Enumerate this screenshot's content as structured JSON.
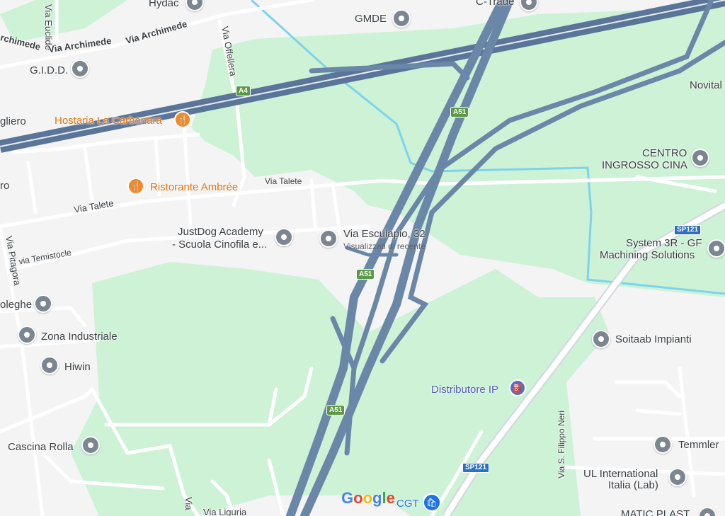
{
  "map": {
    "streets": [
      {
        "id": "via-euclide",
        "text": "Via Euclide"
      },
      {
        "id": "via-archimede-1",
        "text": "rchimede"
      },
      {
        "id": "via-archimede-2",
        "text": "Via Archimede"
      },
      {
        "id": "via-archimede-3",
        "text": "Via Archimede"
      },
      {
        "id": "via-offellera",
        "text": "Via Offellera"
      },
      {
        "id": "via-talete-1",
        "text": "Via Talete"
      },
      {
        "id": "via-talete-2",
        "text": "Via Talete"
      },
      {
        "id": "via-temistocle",
        "text": "via Temistocle"
      },
      {
        "id": "via-pitagora",
        "text": "Via Pitagora"
      },
      {
        "id": "via-s-filippo-neri",
        "text": "Via S. Filippo Neri"
      },
      {
        "id": "via-liguria",
        "text": "Via Liguria"
      },
      {
        "id": "via-partial-left",
        "text": "Via"
      }
    ],
    "shields": [
      {
        "id": "a4",
        "text": "A4"
      },
      {
        "id": "a51-top",
        "text": "A51"
      },
      {
        "id": "a51-mid",
        "text": "A51"
      },
      {
        "id": "a51-bottom",
        "text": "A51"
      },
      {
        "id": "sp121-top",
        "text": "SP121"
      },
      {
        "id": "sp121-bottom",
        "text": "SP121"
      }
    ],
    "places": {
      "hydac": "Hydac",
      "c_trade": "C-Trade",
      "gmde": "GMDE",
      "gidd": "G.I.D.D.",
      "novital": "Novital",
      "gliero": "gliero",
      "hostaria": "Hostaria La Carbonara",
      "ristorante": "Ristorante Ambrée",
      "ro": "ro",
      "centro_ingrosso_1": "CENTRO",
      "centro_ingrosso_2": "INGROSSO CINA",
      "justdog_1": "JustDog Academy",
      "justdog_2": "- Scuola Cinofila e...",
      "via_esculapio": "Via Esculapio, 32",
      "visualizzati": "Visualizzati di recente",
      "system3r_1": "System 3R - GF",
      "system3r_2": "Machining Solutions",
      "oleghe": "oleghe",
      "zona_industriale": "Zona Industriale",
      "soitaab": "Soitaab Impianti",
      "hiwin": "Hiwin",
      "distributore": "Distributore IP",
      "cascina_rolla": "Cascina Rolla",
      "temmler": "Temmler",
      "ul_international_1": "UL International",
      "ul_international_2": "Italia (Lab)",
      "cgt": "CGT",
      "matic_plast": "MATIC PLAST"
    },
    "google_logo": [
      "G",
      "o",
      "o",
      "g",
      "l",
      "e"
    ],
    "colors": {
      "land": "#f4f4f5",
      "green": "#cdf2d6",
      "highway": "#6b87a8",
      "water": "#7dd3ec",
      "food": "#e8710a",
      "fuel": "#5c6bc0",
      "shopping": "#1a73e8"
    },
    "icons": {
      "poi": "place-pin-icon",
      "food": "fork-knife-icon",
      "fuel": "fuel-pump-icon",
      "shopping": "shopping-bag-icon"
    }
  }
}
